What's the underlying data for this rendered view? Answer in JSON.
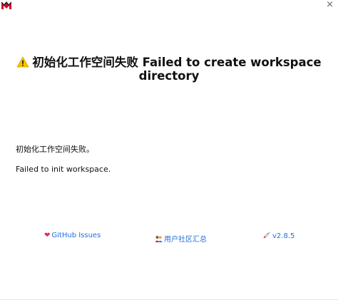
{
  "window": {
    "close_glyph": "×"
  },
  "heading": {
    "line1": "初始化工作空间失败 Failed to create workspace",
    "line2": "directory"
  },
  "messages": {
    "zh": "初始化工作空间失败。",
    "en": "Failed to init workspace."
  },
  "footer": {
    "github_label": "GitHub Issues",
    "community_label": "用户社区汇总",
    "version_label": "v2.8.5"
  },
  "colors": {
    "link": "#1f6fd6",
    "heart": "#e02e4c",
    "warning": "#f5c400"
  }
}
